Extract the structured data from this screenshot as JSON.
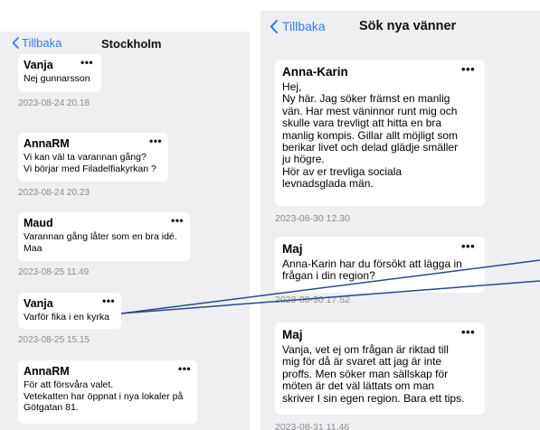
{
  "left": {
    "back_label": "Tillbaka",
    "title": "Stockholm",
    "posts": [
      {
        "author": "Vanja",
        "text": "Nej gunnarsson",
        "time": "2023-08-24 20.18"
      },
      {
        "author": "AnnaRM",
        "text": "Vi kan väl ta varannan gång?\nVi börjar med Filadelfiakyrkan ?",
        "time": "2023-08-24 20.23"
      },
      {
        "author": "Maud",
        "text": "Varannan gång låter som en bra idé.\nMaa",
        "time": "2023-08-25 11.49"
      },
      {
        "author": "Vanja",
        "text": "Varför fika i en kyrka",
        "time": "2023-08-25 15.15"
      },
      {
        "author": "AnnaRM",
        "text": "För att försvåra valet.\nVetekatten har öppnat i nya lokaler på\nGötgatan 81.",
        "time": ""
      }
    ]
  },
  "right": {
    "back_label": "Tillbaka",
    "title": "Sök nya vänner",
    "posts": [
      {
        "author": "Anna-Karin",
        "text": "Hej,\nNy här. Jag söker främst en manlig\nvän. Har mest väninnor  runt mig och\nskulle vara trevligt att hitta en bra\nmanlig kompis. Gillar allt möjligt som\nberikar livet och delad glädje smäller\nju högre.\nHör av er trevliga sociala\nlevnadsglada män.",
        "time": "2023-08-30 12.30"
      },
      {
        "author": "Maj",
        "text": "Anna-Karin har du försökt att lägga in\nfrågan i din region?",
        "time": "2023-08-30 17.52"
      },
      {
        "author": "Maj",
        "text": "Vanja, vet ej om frågan är riktad till\nmig för då är svaret att jag är inte\nproffs. Men söker man sällskap för\nmöten är det väl lättats om man\nskriver I sin egen region. Bara ett tips.",
        "time": "2023-08-31 11.46"
      }
    ]
  },
  "more_glyph": "•••",
  "colors": {
    "background": "#efeff1",
    "bubble": "#ffffff",
    "accent": "#2f7bf5",
    "timestamp": "#8d8d92",
    "annotation_line": "#2b4a8a"
  },
  "icons": {
    "back": "chevron-left-icon",
    "more": "more-options-icon"
  }
}
